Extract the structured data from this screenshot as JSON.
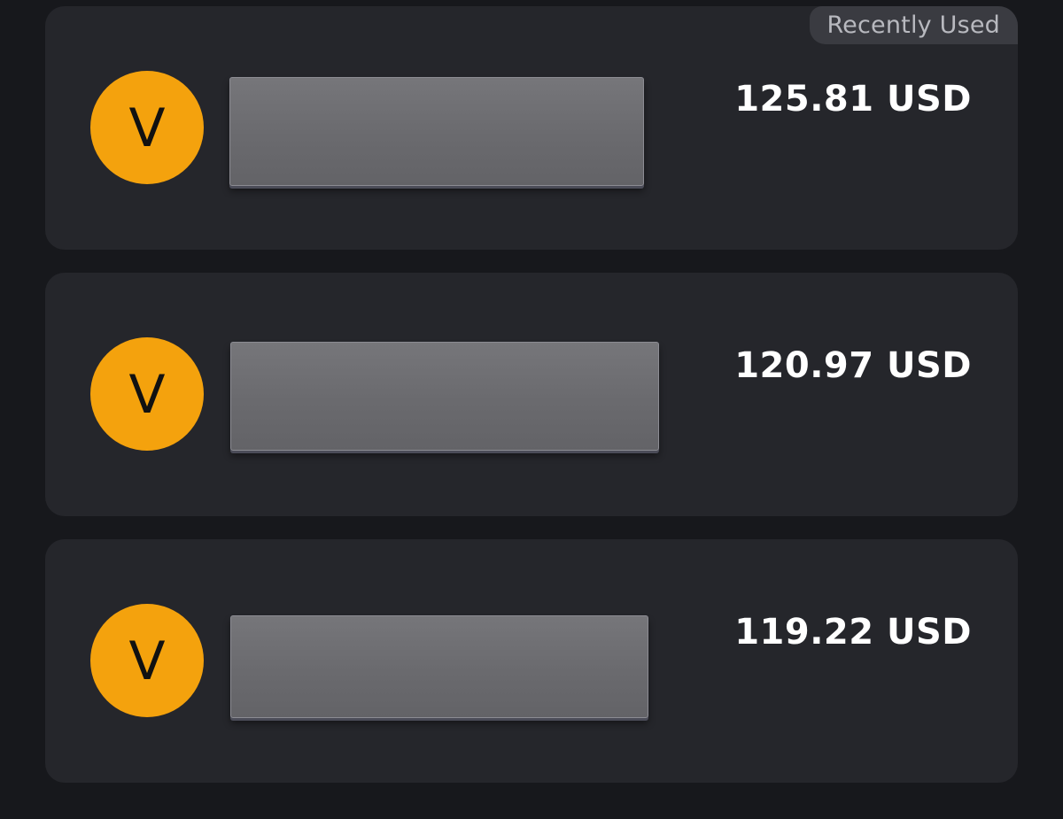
{
  "recently_used_badge": "Recently Used",
  "accent_color": "#f4a20d",
  "accounts": [
    {
      "avatar_letter": "V",
      "name_redacted": true,
      "amount": "125.81 USD"
    },
    {
      "avatar_letter": "V",
      "name_redacted": true,
      "amount": "120.97 USD"
    },
    {
      "avatar_letter": "V",
      "name_redacted": true,
      "amount": "119.22 USD"
    }
  ]
}
